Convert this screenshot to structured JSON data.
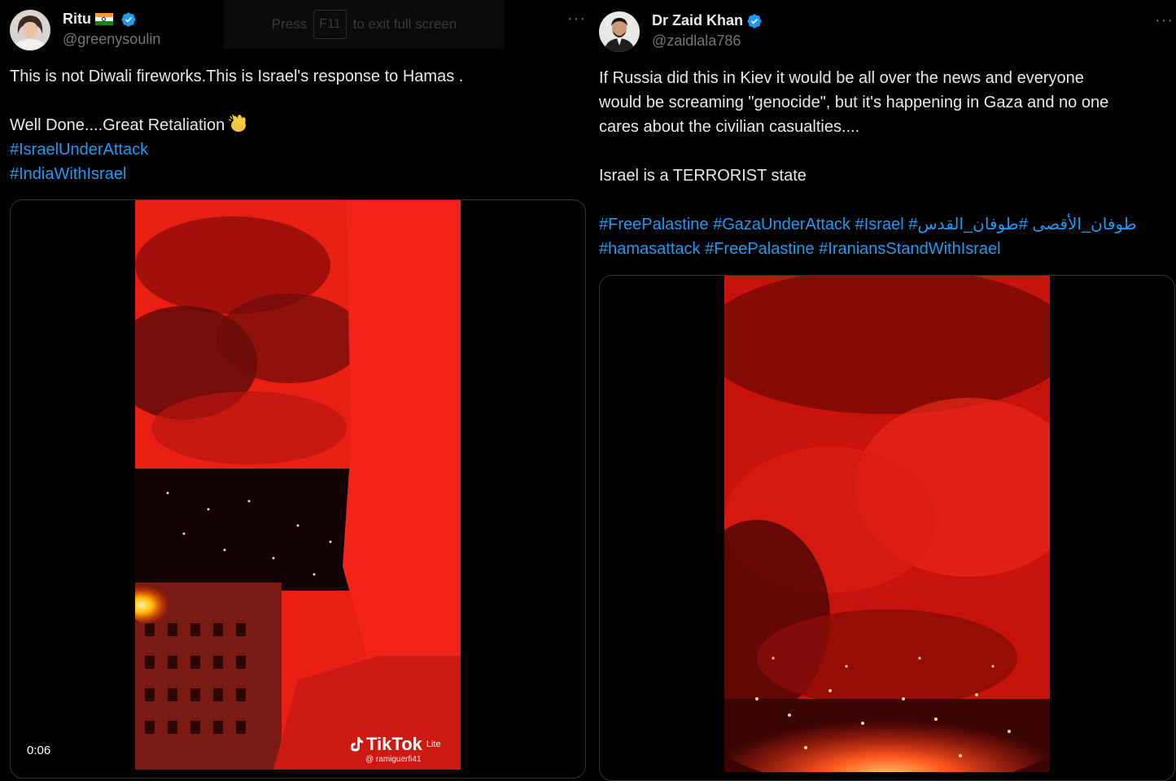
{
  "fullscreen_notice": {
    "press": "Press",
    "key": "F11",
    "suffix": "to exit full screen"
  },
  "tweets": [
    {
      "name": "Ritu",
      "handle": "@greenysoulin",
      "more": "···",
      "text_lines": [
        "This is not Diwali fireworks.This is Israel's response to Hamas .",
        "",
        "Well Done....Great Retaliation"
      ],
      "hashtags": [
        "#IsraelUnderAttack",
        "#IndiaWithIsrael"
      ],
      "video": {
        "time": "0:06",
        "watermark": "TikTok",
        "watermark_sup": "Lite",
        "watermark_user": "@ ramiguerfi41"
      }
    },
    {
      "name": "Dr Zaid Khan",
      "handle": "@zaidlala786",
      "more": "···",
      "text_lines": [
        "If Russia did this in Kiev it would be all over the news and everyone",
        "would be screaming \"genocide\", but it's happening in Gaza and no one",
        "cares about the civilian casualties....",
        "",
        "Israel is a TERRORIST state",
        ""
      ],
      "hashtag_lines": [
        "#FreePalastine #GazaUnderAttack #Israel #طوفان_الأقصى #طوفان_القدس",
        "#hamasattack #FreePalastine #IraniansStandWithIsrael"
      ]
    }
  ],
  "colors": {
    "background": "#000000",
    "text": "#e7e9ea",
    "secondary": "#71767b",
    "link": "#1d9bf0",
    "verified": "#1d9bf0",
    "border": "#2f3336"
  }
}
